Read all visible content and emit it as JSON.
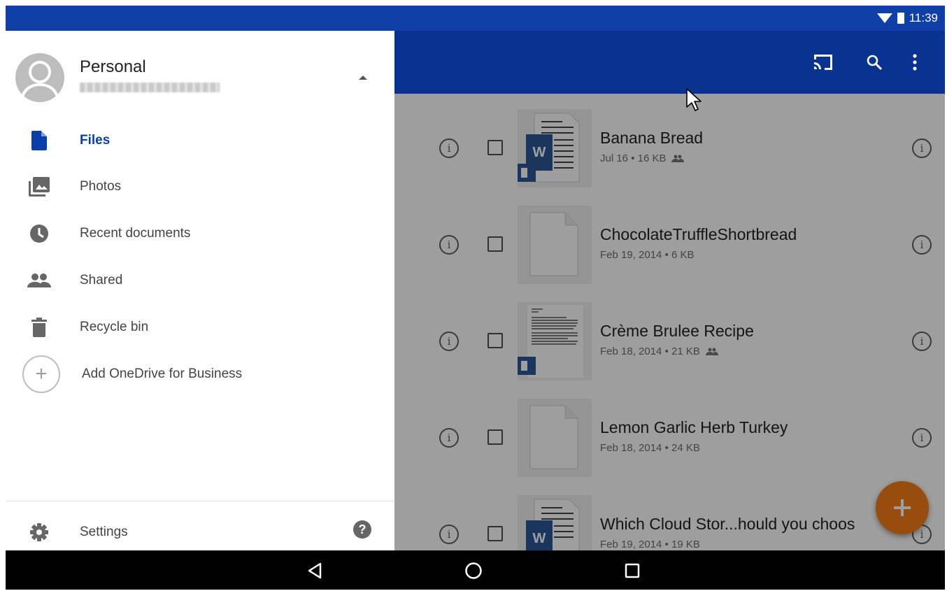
{
  "status_bar": {
    "time": "11:39"
  },
  "account": {
    "name": "Personal"
  },
  "drawer": {
    "items": [
      {
        "label": "Files",
        "icon": "file-icon",
        "active": true
      },
      {
        "label": "Photos",
        "icon": "photos-icon",
        "active": false
      },
      {
        "label": "Recent documents",
        "icon": "clock-icon",
        "active": false
      },
      {
        "label": "Shared",
        "icon": "people-icon",
        "active": false
      },
      {
        "label": "Recycle bin",
        "icon": "trash-icon",
        "active": false
      }
    ],
    "add_business_label": "Add OneDrive for Business",
    "settings_label": "Settings"
  },
  "files": [
    {
      "name": "Banana Bread",
      "meta": "Jul 16 • 16 KB",
      "shared": true,
      "thumb": "word-doc"
    },
    {
      "name": "ChocolateTruffleShortbread",
      "meta": "Feb 19, 2014 • 6 KB",
      "shared": false,
      "thumb": "blank-doc"
    },
    {
      "name": "Crème Brulee Recipe",
      "meta": "Feb 18, 2014 • 21 KB",
      "shared": true,
      "thumb": "text-doc"
    },
    {
      "name": "Lemon Garlic Herb Turkey",
      "meta": "Feb 18, 2014 • 24 KB",
      "shared": false,
      "thumb": "blank-doc"
    },
    {
      "name": "Which Cloud Stor...hould you choos",
      "meta": "Feb 19, 2014 • 19 KB",
      "shared": false,
      "thumb": "word-doc"
    }
  ],
  "colors": {
    "status_bar": "#0f3ea6",
    "app_bar": "#0a3391",
    "accent": "#0a3eaa",
    "fab": "#f57c18",
    "word_blue": "#2b579a"
  },
  "icons": {
    "appbar": [
      "cast-icon",
      "search-icon",
      "more-vert-icon"
    ],
    "nav_bar": [
      "back-icon",
      "home-icon",
      "recents-icon"
    ]
  }
}
